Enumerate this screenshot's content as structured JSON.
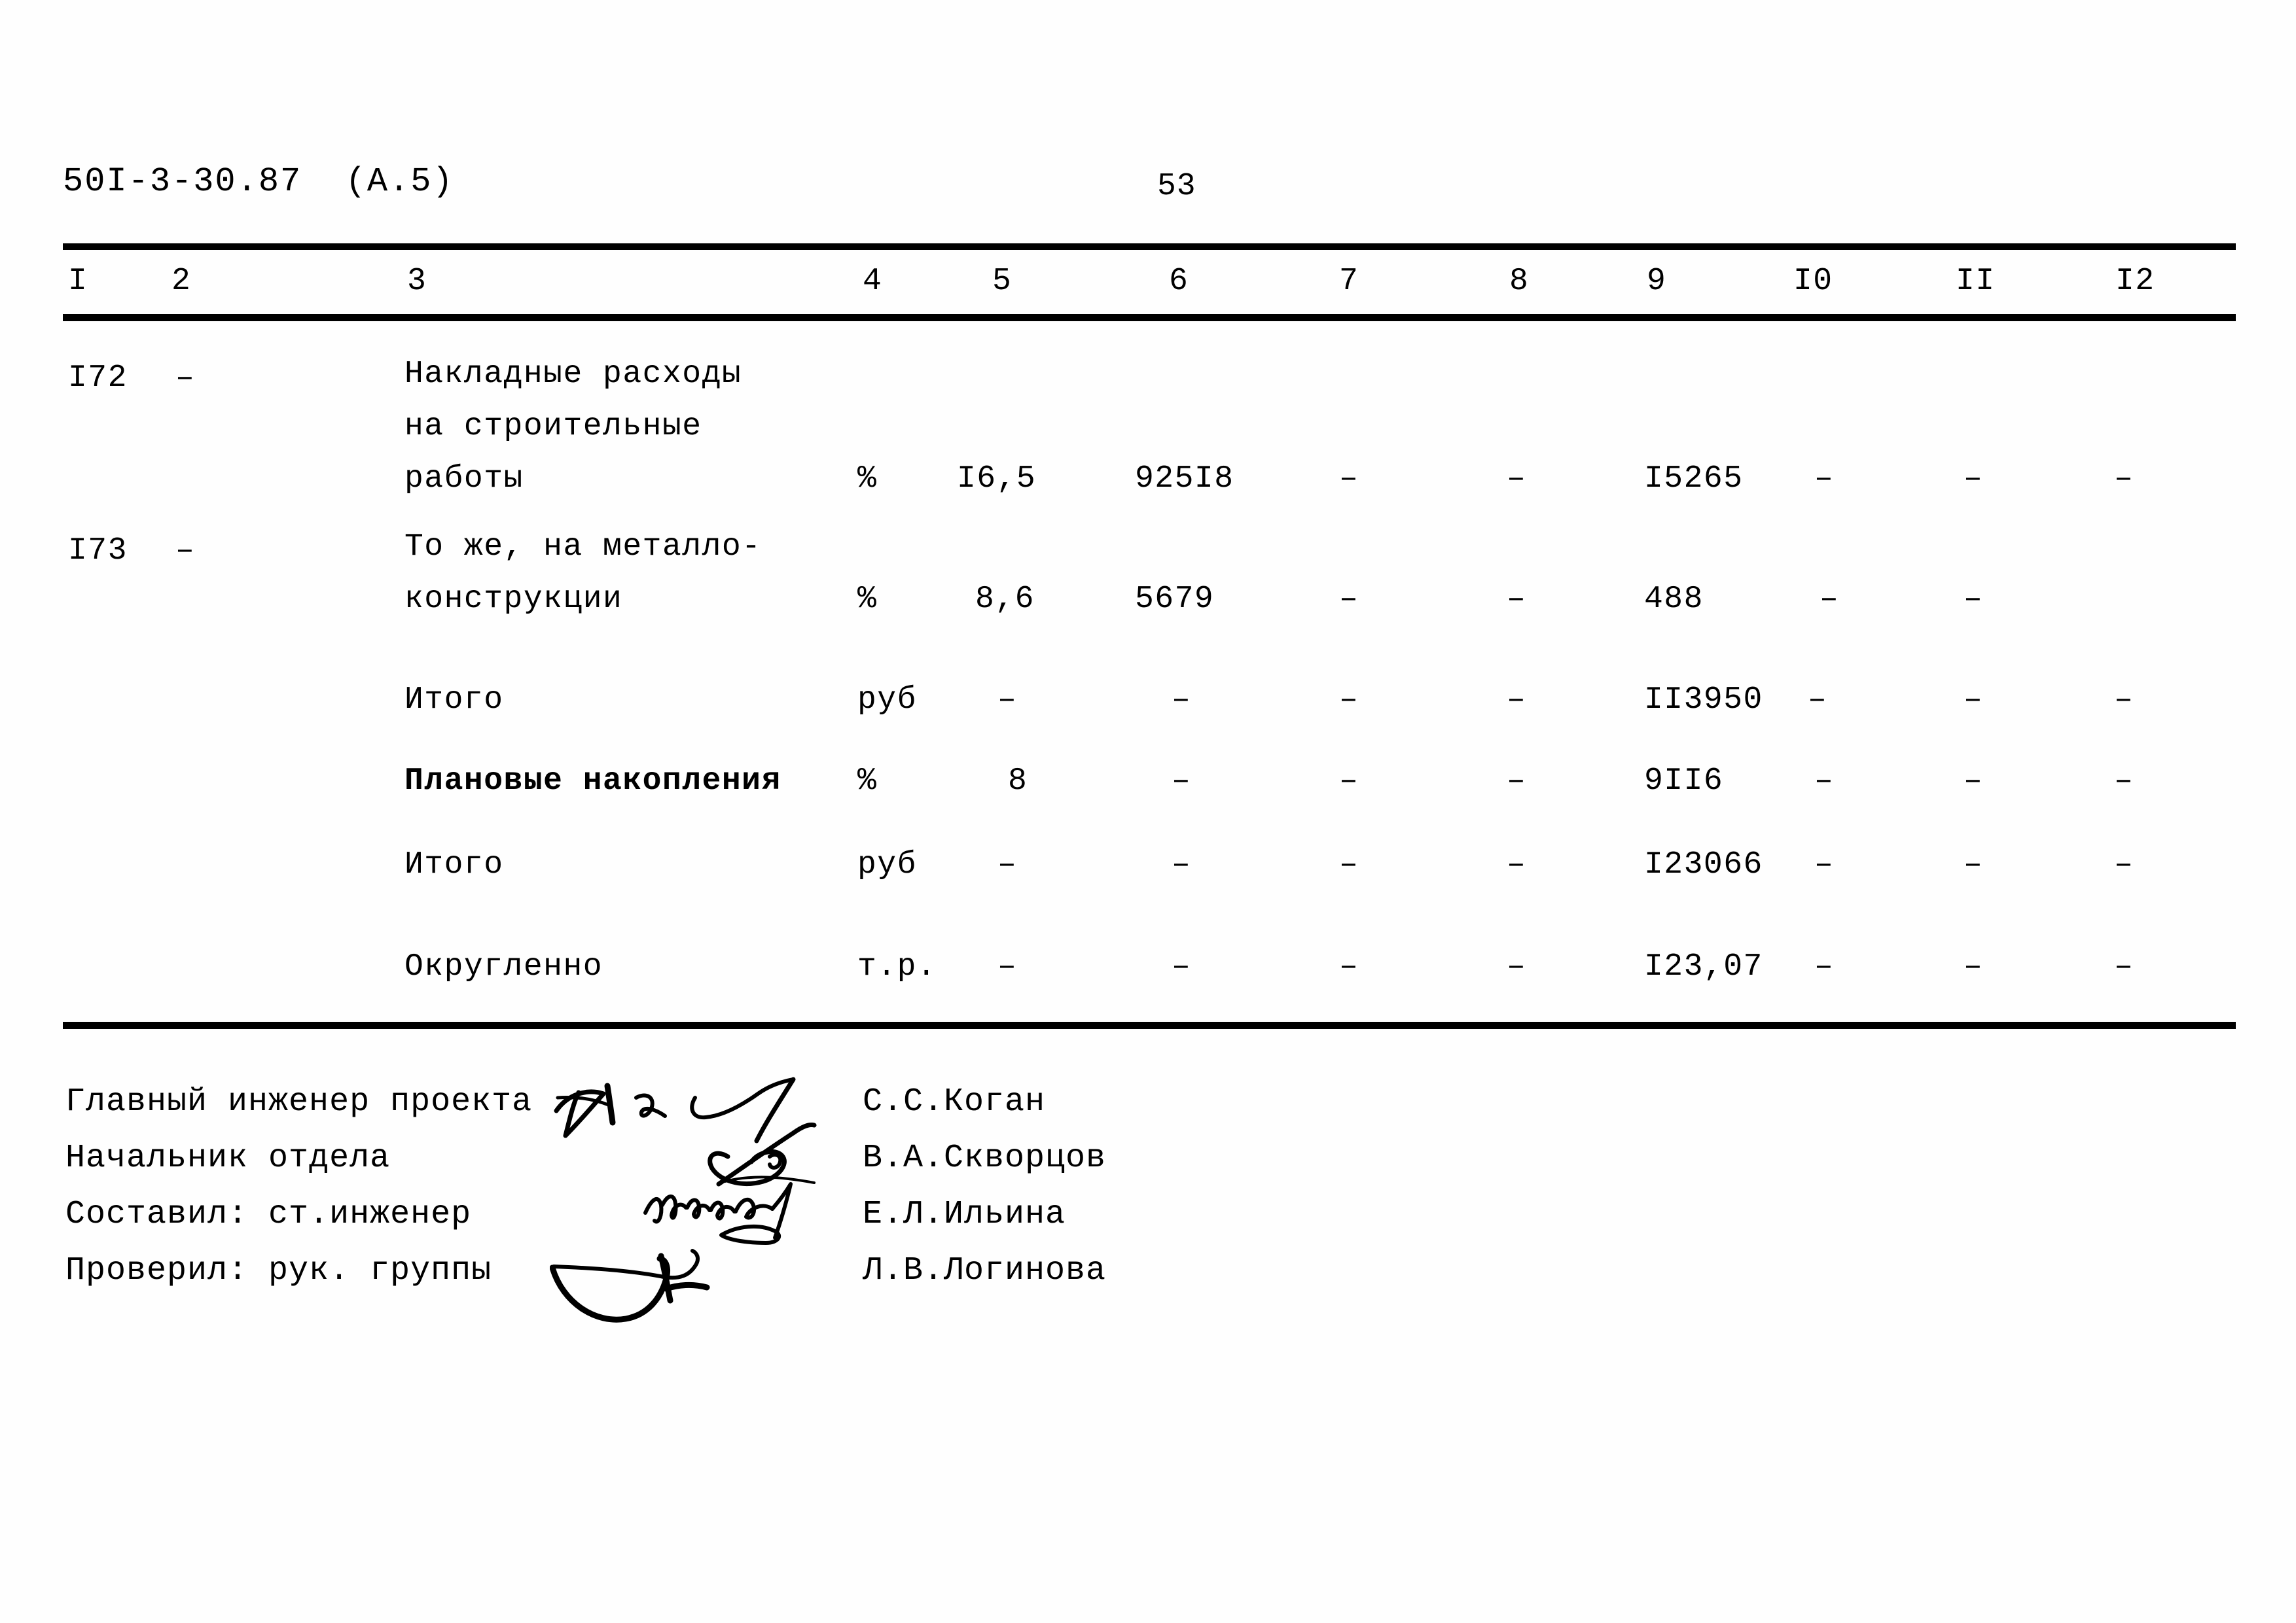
{
  "header": {
    "doc_code": "50I-3-30.87  (А.5)",
    "page_number": "53"
  },
  "table": {
    "column_headers": [
      "I",
      "2",
      "3",
      "4",
      "5",
      "6",
      "7",
      "8",
      "9",
      "I0",
      "II",
      "I2"
    ],
    "rows": [
      {
        "c1": "I72",
        "c2": "–",
        "c3_lines": [
          "Накладные расходы",
          "на строительные",
          "работы"
        ],
        "c4": "%",
        "c5": "I6,5",
        "c6": "925I8",
        "c7": "–",
        "c8": "–",
        "c9": "I5265",
        "c10": "–",
        "c11": "–",
        "c12": "–",
        "emphasis": false
      },
      {
        "c1": "I73",
        "c2": "–",
        "c3_lines": [
          "То же, на металло-",
          "конструкции"
        ],
        "c4": "%",
        "c5": "8,6",
        "c6": "5679",
        "c7": "–",
        "c8": "–",
        "c9": "488",
        "c10": "–",
        "c11": "–",
        "c12": "",
        "emphasis": false
      },
      {
        "c1": "",
        "c2": "",
        "c3_lines": [
          "Итого"
        ],
        "c4": "руб",
        "c5": "–",
        "c6": "–",
        "c7": "–",
        "c8": "–",
        "c9": "II3950",
        "c10": "–",
        "c11": "–",
        "c12": "–",
        "emphasis": false
      },
      {
        "c1": "",
        "c2": "",
        "c3_lines": [
          "Плановые накопления"
        ],
        "c4": "%",
        "c5": "8",
        "c6": "–",
        "c7": "–",
        "c8": "–",
        "c9": "9II6",
        "c10": "–",
        "c11": "–",
        "c12": "–",
        "emphasis": true
      },
      {
        "c1": "",
        "c2": "",
        "c3_lines": [
          "Итого"
        ],
        "c4": "руб",
        "c5": "–",
        "c6": "–",
        "c7": "–",
        "c8": "–",
        "c9": "I23066",
        "c10": "–",
        "c11": "–",
        "c12": "–",
        "emphasis": false
      },
      {
        "c1": "",
        "c2": "",
        "c3_lines": [
          "Округленно"
        ],
        "c4": "т.р.",
        "c5": "–",
        "c6": "–",
        "c7": "–",
        "c8": "–",
        "c9": "I23,07",
        "c10": "–",
        "c11": "–",
        "c12": "–",
        "emphasis": false
      }
    ]
  },
  "signatures": [
    {
      "role": "Главный инженер проекта",
      "name": "С.С.Коган"
    },
    {
      "role": "Начальник отдела",
      "name": "В.А.Скворцов"
    },
    {
      "role": "Составил: ст.инженер",
      "name": "Е.Л.Ильина"
    },
    {
      "role": "Проверил: рук. группы",
      "name": "Л.В.Логинова"
    }
  ],
  "colors": {
    "ink": "#000000",
    "paper": "#fefefe"
  }
}
